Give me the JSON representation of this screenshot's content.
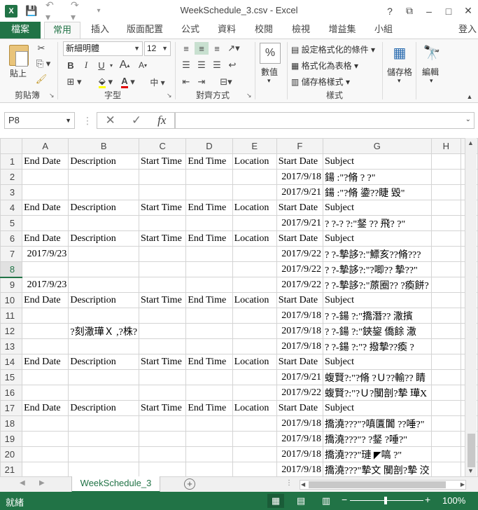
{
  "window": {
    "title": "WeekSchedule_3.csv - Excel",
    "app_icon": "X",
    "help": "?",
    "controls": [
      "?",
      "⧉",
      "–",
      "□",
      "✕"
    ]
  },
  "ribbon_tabs": [
    "檔案",
    "常用",
    "插入",
    "版面配置",
    "公式",
    "資料",
    "校閱",
    "檢視",
    "增益集",
    "小組"
  ],
  "login": "登入",
  "ribbon": {
    "clipboard": {
      "paste": "貼上",
      "label": "剪貼簿"
    },
    "font": {
      "name": "新細明體",
      "size": "12",
      "label": "字型",
      "bold": "B",
      "italic": "I",
      "underline": "U",
      "fontcolor": "A"
    },
    "alignment": {
      "label": "對齊方式"
    },
    "number": {
      "label": "數值",
      "percent": "%"
    },
    "styles": {
      "cond": "設定格式化的條件",
      "table": "格式化為表格",
      "cell": "儲存格樣式",
      "label": "樣式"
    },
    "cells": {
      "label": "儲存格"
    },
    "editing": {
      "label": "編輯"
    }
  },
  "formula_bar": {
    "name_box": "P8",
    "formula": "",
    "fx": "fx"
  },
  "columns": [
    "A",
    "B",
    "C",
    "D",
    "E",
    "F",
    "G",
    "H",
    "I"
  ],
  "rows": [
    {
      "n": "1",
      "a": "End Date",
      "b": "Description",
      "c": "Start Time",
      "d": "End Time",
      "e": "Location",
      "f": "Start Date",
      "g": "Subject"
    },
    {
      "n": "2",
      "a": "",
      "b": "",
      "c": "",
      "d": "",
      "e": "",
      "f": "2017/9/18",
      "g": "鍚      :\"?脩    ?    ?\""
    },
    {
      "n": "3",
      "a": "",
      "b": "",
      "c": "",
      "d": "",
      "e": "",
      "f": "2017/9/21",
      "g": "鍚      :\"?脩    鍌??睫    毀\""
    },
    {
      "n": "4",
      "a": "End Date",
      "b": "Description",
      "c": "Start Time",
      "d": "End Time",
      "e": "Location",
      "f": "Start Date",
      "g": "Subject"
    },
    {
      "n": "5",
      "a": "",
      "b": "",
      "c": "",
      "d": "",
      "e": "",
      "f": "2017/9/21",
      "g": "?    ?-?    ?:\"錖    ??    飛?    ?\""
    },
    {
      "n": "6",
      "a": "End Date",
      "b": "Description",
      "c": "Start Time",
      "d": "End Time",
      "e": "Location",
      "f": "Start Date",
      "g": "Subject"
    },
    {
      "n": "7",
      "a": "2017/9/23",
      "b": "",
      "c": "",
      "d": "",
      "e": "",
      "f": "2017/9/22",
      "g": "?    ?-摯誃?:\"鰾亥??脩???"
    },
    {
      "n": "8",
      "a": "",
      "b": "",
      "c": "",
      "d": "",
      "e": "",
      "f": "2017/9/22",
      "g": "?    ?-摯誃?:\"?唧??        摯??\""
    },
    {
      "n": "9",
      "a": "2017/9/23",
      "b": "",
      "c": "",
      "d": "",
      "e": "",
      "f": "2017/9/22",
      "g": "?    ?-摯誃?:\"蒝圈??    ?瘓餅?"
    },
    {
      "n": "10",
      "a": "End Date",
      "b": "Description",
      "c": "Start Time",
      "d": "End Time",
      "e": "Location",
      "f": "Start Date",
      "g": "Subject"
    },
    {
      "n": "11",
      "a": "",
      "b": "",
      "c": "",
      "d": "",
      "e": "",
      "f": "2017/9/18",
      "g": "?    ?-鍚    ?:\"撟潛??      潵擯"
    },
    {
      "n": "12",
      "a": "",
      "b": "?刻潵璍Ｘ     ,?株?",
      "c": "",
      "d": "",
      "e": "",
      "f": "2017/9/18",
      "g": "?    ?-鍚    ?:\"鋏鋆    僑餘    潵"
    },
    {
      "n": "13",
      "a": "",
      "b": "",
      "c": "",
      "d": "",
      "e": "",
      "f": "2017/9/18",
      "g": "?    ?-鍚    ?:\"?    撥摯??瘓    ?"
    },
    {
      "n": "14",
      "a": "End Date",
      "b": "Description",
      "c": "Start Time",
      "d": "End Time",
      "e": "Location",
      "f": "Start Date",
      "g": "Subject"
    },
    {
      "n": "15",
      "a": "",
      "b": "",
      "c": "",
      "d": "",
      "e": "",
      "f": "2017/9/21",
      "g": "蝮賢?:\"?脩    ?Ｕ??輸??        睛"
    },
    {
      "n": "16",
      "a": "",
      "b": "",
      "c": "",
      "d": "",
      "e": "",
      "f": "2017/9/22",
      "g": "蝮賢?:\"?Ｕ?闃剖?摯        璍X"
    },
    {
      "n": "17",
      "a": "End Date",
      "b": "Description",
      "c": "Start Time",
      "d": "End Time",
      "e": "Location",
      "f": "Start Date",
      "g": "Subject"
    },
    {
      "n": "18",
      "a": "",
      "b": "",
      "c": "",
      "d": "",
      "e": "",
      "f": "2017/9/18",
      "g": "撟澆???\"?嗔匱闐    ??唾?\""
    },
    {
      "n": "19",
      "a": "",
      "b": "",
      "c": "",
      "d": "",
      "e": "",
      "f": "2017/9/18",
      "g": "撟澆???\"?    ?錖        ?唾?\""
    },
    {
      "n": "20",
      "a": "",
      "b": "",
      "c": "",
      "d": "",
      "e": "",
      "f": "2017/9/18",
      "g": "撟澆???\"璉    ◤嗃    ?\""
    },
    {
      "n": "21",
      "a": "",
      "b": "",
      "c": "",
      "d": "",
      "e": "",
      "f": "2017/9/18",
      "g": "撟澆???\"摯文    闃剖?摯    洨"
    }
  ],
  "sheet_tabs": [
    "WeekSchedule_3"
  ],
  "status": {
    "ready": "就緒",
    "zoom": "100%",
    "minus": "−",
    "plus": "+"
  }
}
